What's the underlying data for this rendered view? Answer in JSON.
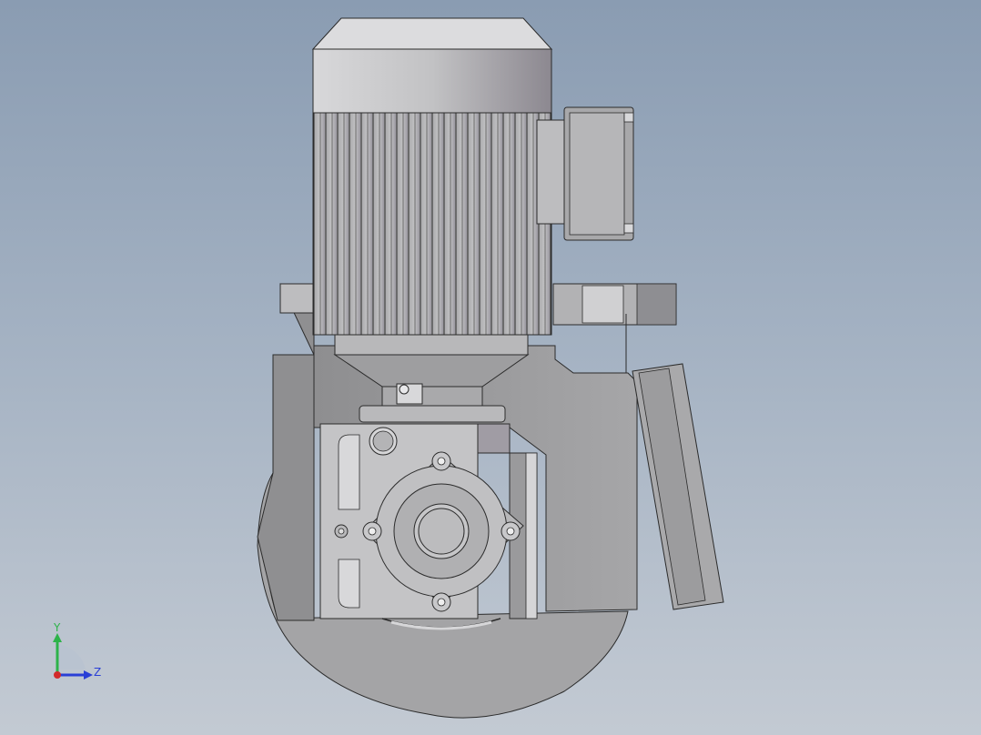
{
  "view": {
    "kind": "cad-model-viewport",
    "model_description_icon": "gearmotor-model",
    "background_top": "#8a9cb2",
    "background_bottom": "#c3cad3"
  },
  "triad": {
    "y_label": "Y",
    "z_label": "Z",
    "y_color": "#2db34a",
    "z_color": "#2a3fd6",
    "origin_color": "#d22b2b"
  },
  "colors": {
    "metal_light": "#c9c9cb",
    "metal_mid": "#a9a9ab",
    "metal_dark": "#7e7e80",
    "edge": "#2b2b2b",
    "motor_cap": "#bdbdbf"
  }
}
